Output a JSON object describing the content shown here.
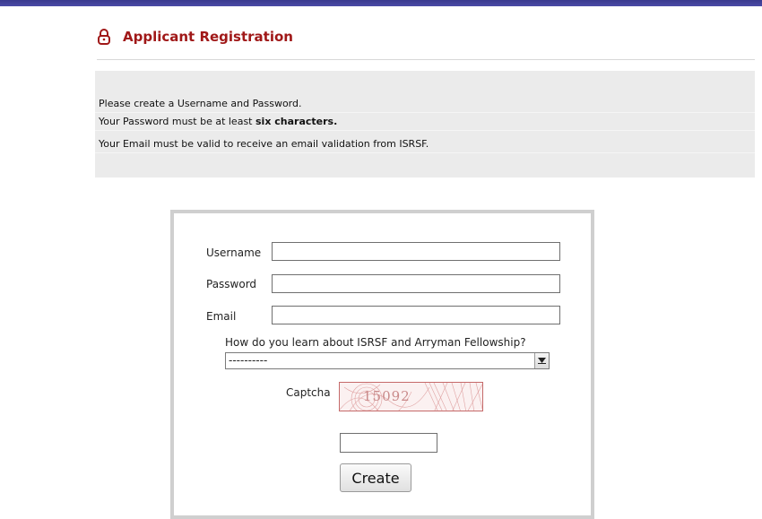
{
  "header": {
    "title": "Applicant Registration",
    "icon": "lock-icon",
    "accent_color": "#a01818",
    "bar_color": "#3f3f99"
  },
  "notice": {
    "line1": "Please create a Username and Password.",
    "line2_prefix": "Your Password must be at least ",
    "line2_bold": "six characters.",
    "line3": "Your Email must be valid to receive an email validation from ISRSF."
  },
  "form": {
    "username_label": "Username",
    "username_value": "",
    "password_label": "Password",
    "password_value": "",
    "email_label": "Email",
    "email_value": "",
    "source_question": "How do you learn about ISRSF and Arryman Fellowship?",
    "source_selected": "----------",
    "captcha_label": "Captcha",
    "captcha_code": "15092",
    "captcha_input_value": "",
    "create_label": "Create"
  }
}
